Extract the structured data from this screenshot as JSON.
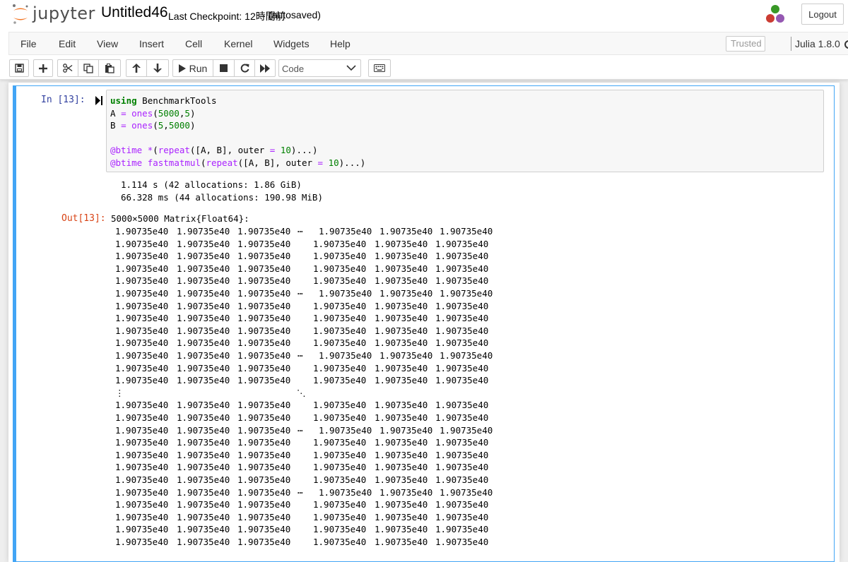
{
  "header": {
    "logo_text": "jupyter",
    "notebook_name": "Untitled46",
    "checkpoint": "Last Checkpoint: 12時間前",
    "autosave_status": "(autosaved)",
    "logout_label": "Logout"
  },
  "menubar": {
    "items": [
      "File",
      "Edit",
      "View",
      "Insert",
      "Cell",
      "Kernel",
      "Widgets",
      "Help"
    ],
    "trusted_label": "Trusted",
    "kernel_name": "Julia 1.8.0"
  },
  "toolbar": {
    "run_label": "Run",
    "cell_type": "Code",
    "icons": [
      "save-icon",
      "plus-icon",
      "scissors-icon",
      "copy-icon",
      "paste-icon",
      "arrow-up-icon",
      "arrow-down-icon",
      "play-icon",
      "stop-icon",
      "restart-icon",
      "fast-forward-icon",
      "keyboard-icon"
    ]
  },
  "cell": {
    "in_prompt": "In [13]:",
    "out_prompt": "Out[13]:",
    "code_lines": [
      "using BenchmarkTools",
      "A = ones(5000,5)",
      "B = ones(5,5000)",
      "",
      "@btime *(repeat([A, B], outer = 10)...)",
      "@btime fastmatmul(repeat([A, B], outer = 10)...)"
    ],
    "stream_lines": [
      "1.114 s (42 allocations: 1.86 GiB)",
      "66.328 ms (44 allocations: 190.98 MiB)"
    ],
    "result_header": "5000×5000 Matrix{Float64}:",
    "matrix_value": "1.90735e40",
    "hdots": "⋯",
    "vdots": "⋮",
    "ddots": "⋱"
  },
  "colors": {
    "cell_border": "#42a5f5",
    "in_prompt": "#303f9f",
    "out_prompt": "#d84315"
  }
}
